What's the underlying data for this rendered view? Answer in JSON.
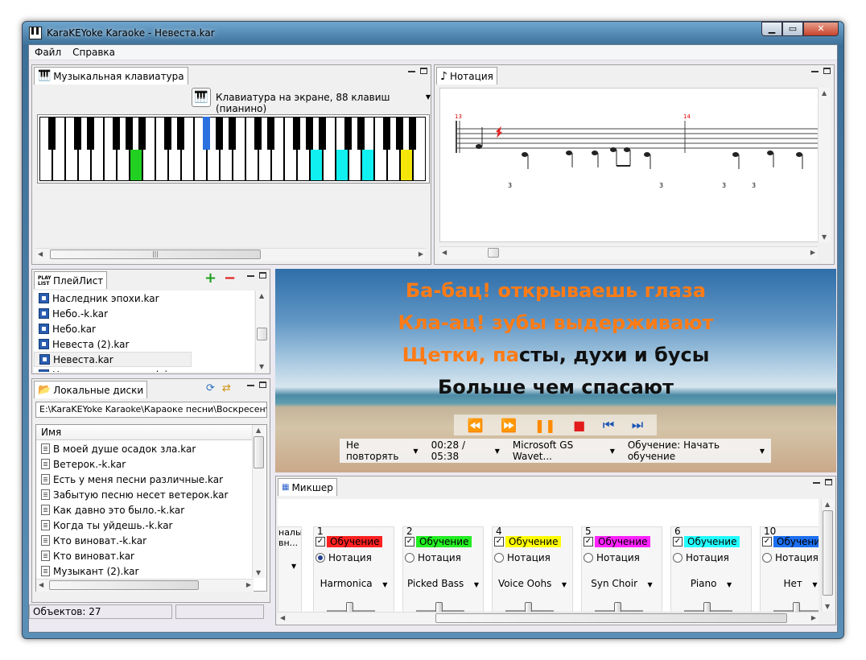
{
  "window": {
    "title": "KaraKEYoke Karaoke - Невеста.kar",
    "minimize": "▁",
    "maximize": "▭",
    "close": "✕"
  },
  "menu": [
    "Файл",
    "Справка"
  ],
  "keyboard_panel": {
    "tab": "Музыкальная клавиатура",
    "selector": "Клавиатура на экране, 88 клавиш (пианино)"
  },
  "notation_panel": {
    "tab": "Нотация",
    "measure_numbers": [
      "13",
      "14"
    ],
    "tuplets": [
      "3",
      "3",
      "3",
      "3"
    ]
  },
  "playlist_panel": {
    "tab": "ПлейЛист",
    "icon_text": "PLAY LIST",
    "items": [
      "Наследник эпохи.kar",
      "Небо.-k.kar",
      "Небо.kar",
      "Невеста (2).kar",
      "Невеста.kar",
      "Новая луна апреля.-k.kar"
    ],
    "selected_index": 4
  },
  "disks_panel": {
    "tab": "Локальные диски",
    "path": "E:\\KaraKEYoke Karaoke\\Караоке песни\\Воскресен",
    "column": "Имя",
    "items": [
      "В моей душе осадок зла.kar",
      "Ветерок.-k.kar",
      "Есть у меня песни различные.kar",
      "Забытую песню несет ветерок.kar",
      "Как давно это было.-k.kar",
      "Когда ты уйдешь.-k.kar",
      "Кто виноват.-k.kar",
      "Кто виноват.kar",
      "Музыкант (2).kar",
      "Музыкант.kar"
    ]
  },
  "status": {
    "objects": "Объектов: 27"
  },
  "lyrics": {
    "line1": "Ба-бац! открываешь глаза",
    "line2": "Кла-ац! зубы выдерживают",
    "line3_sung": "Щетки, па",
    "line3_rest": "сты, духи и бусы",
    "line4": "Больше чем спасают",
    "sung_color": "#ff7b15",
    "unsung_color": "#111111"
  },
  "player": {
    "repeat": "Не повторять",
    "time": "00:28 / 05:38",
    "device": "Microsoft GS Wavet...",
    "training": "Обучение: Начать обучение"
  },
  "mixer": {
    "tab": "Микшер",
    "partial_label_1": "налы",
    "partial_label_2": "вн...",
    "channels": [
      {
        "num": "1",
        "check": "Обучение",
        "color": "#ff2020",
        "radio": "Нотация",
        "on": true,
        "instrument": "Harmonica"
      },
      {
        "num": "2",
        "check": "Обучение",
        "color": "#22ee22",
        "radio": "Нотация",
        "on": false,
        "instrument": "Picked Bass"
      },
      {
        "num": "4",
        "check": "Обучение",
        "color": "#ffff00",
        "radio": "Нотация",
        "on": false,
        "instrument": "Voice Oohs"
      },
      {
        "num": "5",
        "check": "Обучение",
        "color": "#ff22ff",
        "radio": "Нотация",
        "on": false,
        "instrument": "Syn Choir"
      },
      {
        "num": "6",
        "check": "Обучение",
        "color": "#22ffff",
        "radio": "Нотация",
        "on": false,
        "instrument": "Piano"
      },
      {
        "num": "10",
        "check": "Обучение",
        "color": "#1c6ff0",
        "radio": "Нотация",
        "on": false,
        "instrument": "Нет"
      }
    ]
  }
}
